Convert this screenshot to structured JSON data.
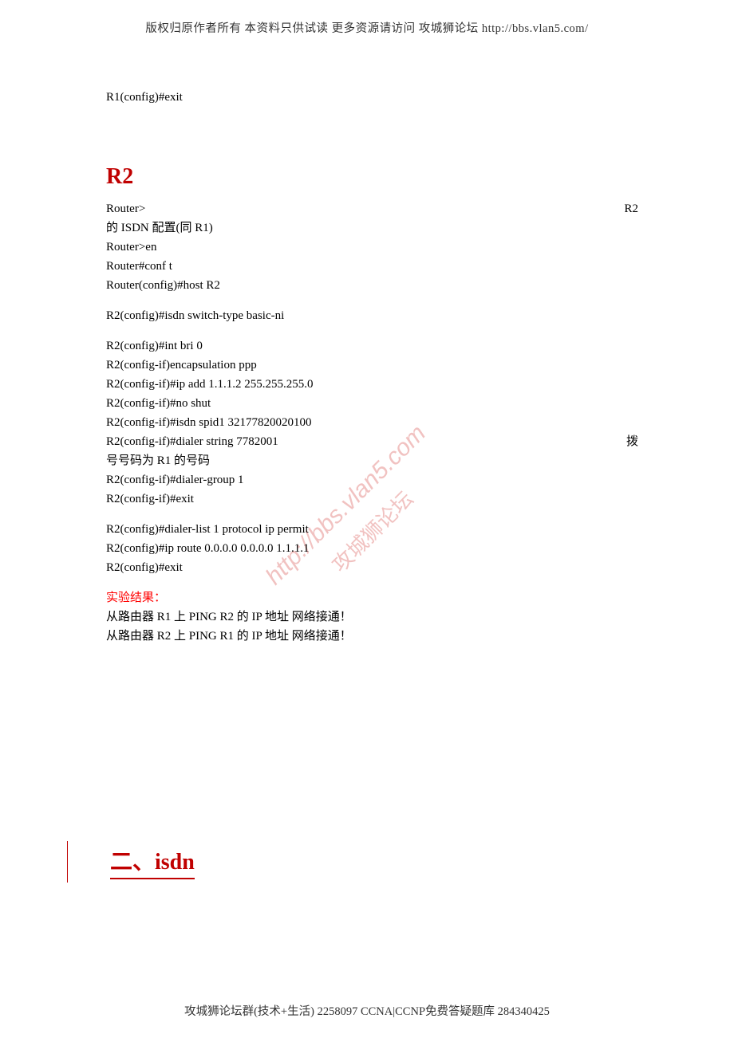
{
  "header": "版权归原作者所有 本资料只供试读 更多资源请访问 攻城狮论坛 http://bbs.vlan5.com/",
  "footer": "攻城狮论坛群(技术+生活) 2258097 CCNA|CCNP免费答疑题库 284340425",
  "top_exit": "R1(config)#exit",
  "r2_heading": "R2",
  "watermark_url": "http://bbs.vlan5.com",
  "watermark_text": "攻城狮论坛",
  "r2_block1_left": "Router>",
  "r2_block1_right": "R2",
  "r2_block1_l2": "的 ISDN 配置(同 R1)",
  "r2_block1_l3": "Router>en",
  "r2_block1_l4": "Router#conf t",
  "r2_block1_l5": "Router(config)#host R2",
  "r2_block2_l1": "R2(config)#isdn switch-type basic-ni",
  "r2_block3_l1": "R2(config)#int bri 0",
  "r2_block3_l2": "R2(config-if)encapsulation ppp",
  "r2_block3_l3": "R2(config-if)#ip add 1.1.1.2 255.255.255.0",
  "r2_block3_l4": "R2(config-if)#no shut",
  "r2_block3_l5": "R2(config-if)#isdn spid1 32177820020100",
  "r2_block3_l6_left": "R2(config-if)#dialer string 7782001",
  "r2_block3_l6_right": "拨",
  "r2_block3_l7": "号号码为 R1 的号码",
  "r2_block3_l8": "R2(config-if)#dialer-group 1",
  "r2_block3_l9": "R2(config-if)#exit",
  "r2_block4_l1": "R2(config)#dialer-list 1 protocol ip permit",
  "r2_block4_l2": "R2(config)#ip route 0.0.0.0 0.0.0.0 1.1.1.1",
  "r2_block4_l3": "R2(config)#exit",
  "result_label": "实验结果：",
  "result_l1": "从路由器 R1 上 PING R2 的 IP 地址  网络接通！",
  "result_l2": "从路由器 R2 上 PING R1 的 IP 地址  网络接通！",
  "section2_title": "二、isdn"
}
